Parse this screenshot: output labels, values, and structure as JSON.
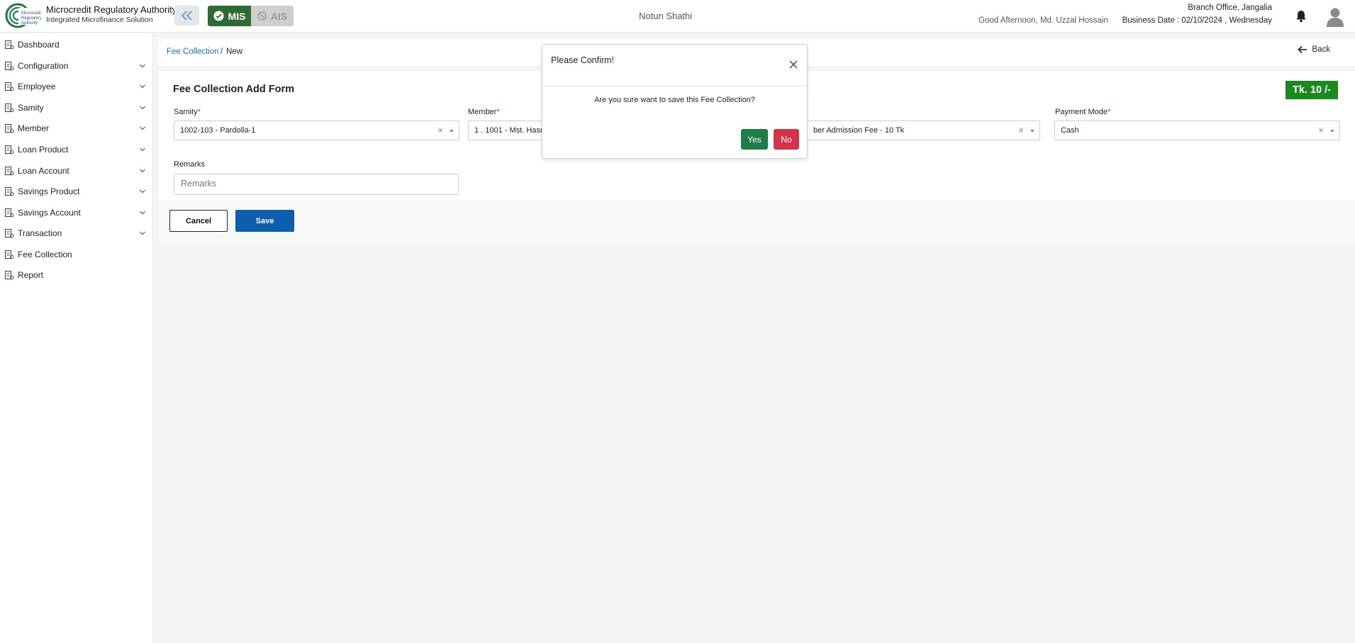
{
  "header": {
    "brand_title": "Microcredit Regulatory Authority",
    "brand_subtitle": "Integrated Microfinance Solution",
    "logo_text": "Microcredit Regulatory Authority",
    "mode_mis": "MIS",
    "mode_ais": "AIS",
    "org_name": "Notun Shathi",
    "greeting": "Good Afternoon, Md. Uzzal Hossain",
    "branch": "Branch Office, Jangalia",
    "business_date": "Business Date : 02/10/2024 , Wednesday"
  },
  "sidebar": {
    "items": [
      {
        "label": "Dashboard",
        "icon": "dashboard-icon",
        "expandable": false
      },
      {
        "label": "Configuration",
        "icon": "sliders-icon",
        "expandable": true
      },
      {
        "label": "Employee",
        "icon": "employee-icon",
        "expandable": true
      },
      {
        "label": "Samity",
        "icon": "samity-icon",
        "expandable": true
      },
      {
        "label": "Member",
        "icon": "member-icon",
        "expandable": true
      },
      {
        "label": "Loan Product",
        "icon": "loan-product-icon",
        "expandable": true
      },
      {
        "label": "Loan Account",
        "icon": "loan-account-icon",
        "expandable": true
      },
      {
        "label": "Savings Product",
        "icon": "savings-product-icon",
        "expandable": true
      },
      {
        "label": "Savings Account",
        "icon": "savings-account-icon",
        "expandable": true
      },
      {
        "label": "Transaction",
        "icon": "transaction-icon",
        "expandable": true
      },
      {
        "label": "Fee Collection",
        "icon": "fee-collection-icon",
        "expandable": false
      },
      {
        "label": "Report",
        "icon": "report-icon",
        "expandable": false
      }
    ]
  },
  "breadcrumb": {
    "parent": "Fee Collection",
    "separator": "/",
    "current": "New",
    "back_label": "Back"
  },
  "form": {
    "title": "Fee Collection Add Form",
    "amount": "Tk. 10 /-",
    "samity_label": "Samity",
    "samity_value": "1002-103 - Pardolla-1",
    "member_label": "Member",
    "member_value": "1 . 1001 - Mst. Hasna",
    "fee_value": "ber Admission Fee - 10 Tk",
    "payment_mode_label": "Payment Mode",
    "payment_mode_value": "Cash",
    "remarks_label": "Remarks",
    "remarks_placeholder": "Remarks",
    "required_mark": "*",
    "clear_glyph": "×",
    "cancel_label": "Cancel",
    "save_label": "Save"
  },
  "modal": {
    "title": "Please Confirm!",
    "message": "Are you sure want to save this Fee Collection?",
    "yes_label": "Yes",
    "no_label": "No"
  },
  "colors": {
    "mis_green": "#2d6b34",
    "amount_green": "#1a8a1f",
    "save_blue": "#0d5fad",
    "link_blue": "#1a73c6",
    "yes_green": "#1e7e4a",
    "no_red": "#d6334b"
  }
}
